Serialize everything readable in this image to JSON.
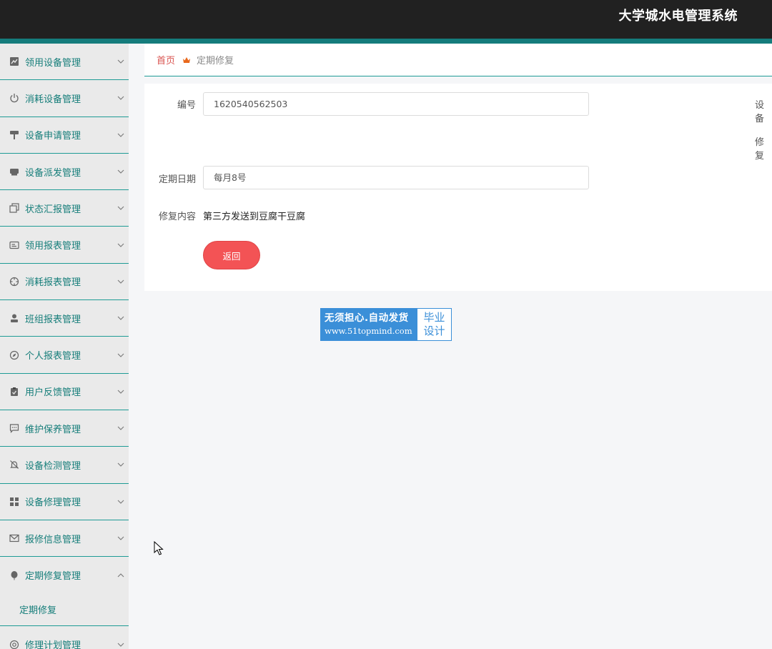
{
  "header": {
    "app_title": "大学城水电管理系统"
  },
  "colors": {
    "topbar": "#212121",
    "accent": "#157c7c",
    "menu_text": "#167e7a",
    "danger": "#f35355",
    "home_link": "#d9534f"
  },
  "sidebar": {
    "items": [
      {
        "label": "领用设备管理",
        "icon": "chart-icon",
        "expanded": false
      },
      {
        "label": "消耗设备管理",
        "icon": "power-icon",
        "expanded": false
      },
      {
        "label": "设备申请管理",
        "icon": "paint-roller-icon",
        "expanded": false
      },
      {
        "label": "设备派发管理",
        "icon": "printer-icon",
        "expanded": false
      },
      {
        "label": "状态汇报管理",
        "icon": "copy-icon",
        "expanded": false
      },
      {
        "label": "领用报表管理",
        "icon": "id-card-icon",
        "expanded": false
      },
      {
        "label": "消耗报表管理",
        "icon": "crosshair-icon",
        "expanded": false
      },
      {
        "label": "班组报表管理",
        "icon": "user-icon",
        "expanded": false
      },
      {
        "label": "个人报表管理",
        "icon": "compass-icon",
        "expanded": false
      },
      {
        "label": "用户反馈管理",
        "icon": "clipboard-icon",
        "expanded": false
      },
      {
        "label": "维护保养管理",
        "icon": "chat-icon",
        "expanded": false
      },
      {
        "label": "设备检测管理",
        "icon": "bell-off-icon",
        "expanded": false
      },
      {
        "label": "设备修理管理",
        "icon": "grid-icon",
        "expanded": false
      },
      {
        "label": "报修信息管理",
        "icon": "mail-icon",
        "expanded": false
      },
      {
        "label": "定期修复管理",
        "icon": "balloon-icon",
        "expanded": true
      },
      {
        "label": "修理计划管理",
        "icon": "help-icon",
        "expanded": false
      }
    ],
    "sub_item": "定期修复"
  },
  "breadcrumb": {
    "home": "首页",
    "current": "定期修复"
  },
  "form": {
    "id_label": "编号",
    "id_value": "1620540562503",
    "schedule_label": "定期日期",
    "schedule_value": "每月8号",
    "content_label": "修复内容",
    "content_value": "第三方发送到豆腐干豆腐",
    "right_label_1": "设备",
    "right_label_2": "修复",
    "back_label": "返回"
  },
  "watermark": {
    "line1": "无须担心.自动发货",
    "line2": "www.51topmind.com",
    "right1": "毕业",
    "right2": "设计"
  }
}
